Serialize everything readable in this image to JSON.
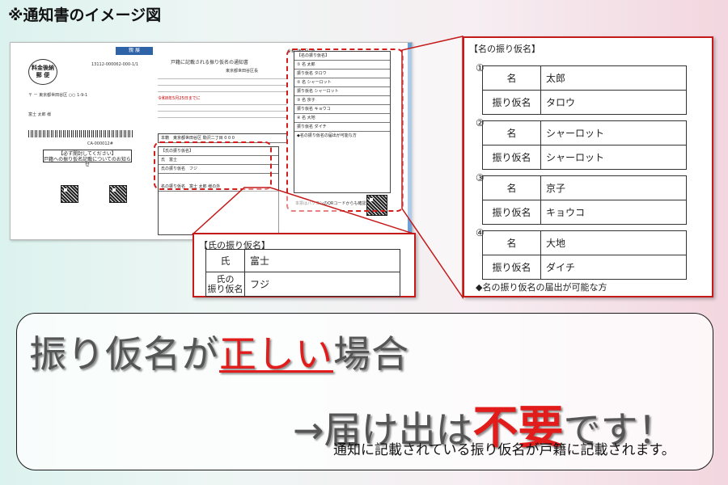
{
  "heading": "※通知書のイメージ図",
  "document": {
    "tag": "親 展",
    "stamp": [
      "料金後納",
      "郵 便"
    ],
    "title": "戸籍に記載される振り仮名の通知書",
    "issuer": "東京都世田谷区長",
    "date": "令和7年5月1日",
    "address_code": "13112-000062-000-1/1",
    "must_open": [
      "【必ず開封してください】",
      "戸籍への振り仮名記載についてのお知らせ"
    ],
    "code": "CA-000012#",
    "honseki_label": "本籍",
    "honseki_value": "東京都世田谷区 駒沢二丁目 0 0 0",
    "name_owner": "富士 太郎 様の外",
    "small_note": "本票はパソコンのQRコードからも確認できます",
    "deadline_note": "令和8年5月25日までに",
    "name_section_title": "【名の振り仮名】",
    "surname_section_title": "【氏の振り仮名】"
  },
  "surname_callout": {
    "title": "【氏の振り仮名】",
    "rows": [
      {
        "label": "氏",
        "value": "富士"
      },
      {
        "label": "氏の\n振り仮名",
        "value": "フジ"
      }
    ]
  },
  "name_callout": {
    "title": "【名の振り仮名】",
    "entries": [
      {
        "num": "①",
        "name_label": "名",
        "name": "太郎",
        "kana_label": "振り仮名",
        "kana": "タロウ"
      },
      {
        "num": "②",
        "name_label": "名",
        "name": "シャーロット",
        "kana_label": "振り仮名",
        "kana": "シャーロット"
      },
      {
        "num": "③",
        "name_label": "名",
        "name": "京子",
        "kana_label": "振り仮名",
        "kana": "キョウコ"
      },
      {
        "num": "④",
        "name_label": "名",
        "name": "大地",
        "kana_label": "振り仮名",
        "kana": "ダイチ"
      }
    ],
    "footer": "◆名の振り仮名の届出が可能な方"
  },
  "message": {
    "line1_pre": "振り仮名が",
    "line1_red": "正しい",
    "line1_post": "場合",
    "line2_pre": "→届け出は",
    "line2_red": "不要",
    "line2_post": "です！",
    "sub": "通知に記載されている振り仮名が戸籍に記載されます。"
  },
  "colors": {
    "accent_red": "#e21b1b",
    "frame_red": "#c41a1a",
    "tag_blue": "#2f63a8"
  }
}
